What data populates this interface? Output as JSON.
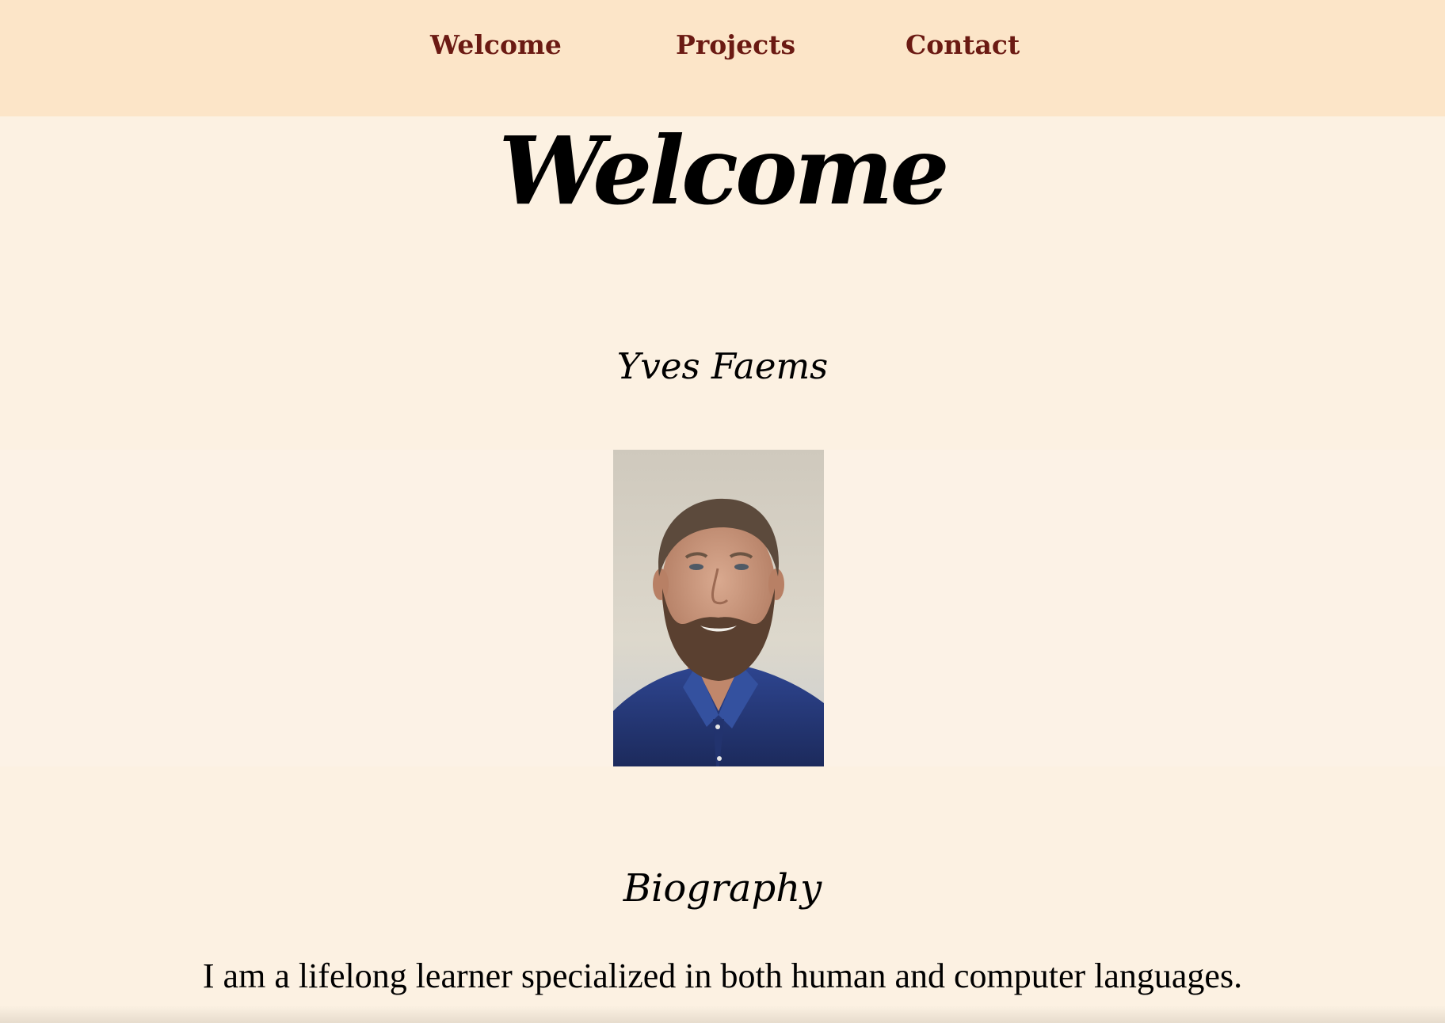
{
  "nav": {
    "items": [
      {
        "label": "Welcome"
      },
      {
        "label": "Projects"
      },
      {
        "label": "Contact"
      }
    ]
  },
  "main": {
    "title": "Welcome",
    "name": "Yves Faems",
    "photo_alt": "Portrait photo of Yves Faems",
    "biography": {
      "heading": "Biography",
      "text": "I am a lifelong learner specialized in both human and computer languages."
    }
  },
  "colors": {
    "nav_background": "#fce5c8",
    "page_background": "#fcf1e2",
    "nav_link": "#6b1a13"
  }
}
